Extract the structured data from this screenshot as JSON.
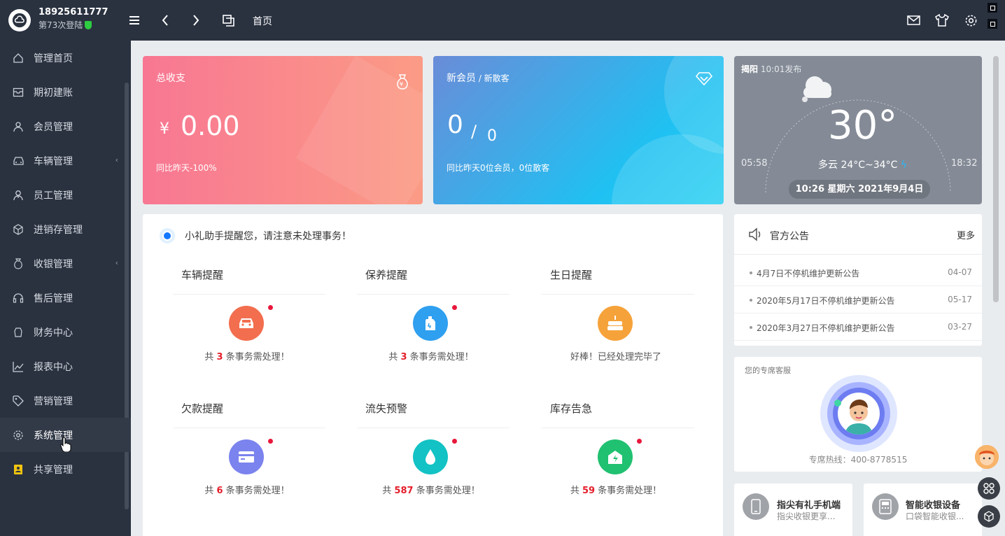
{
  "user": {
    "phone": "18925611777",
    "login_count": "第73次登陆"
  },
  "topbar": {
    "title": "首页"
  },
  "menu": [
    {
      "label": "管理首页",
      "icon": "home-icon"
    },
    {
      "label": "期初建账",
      "icon": "inbox-icon"
    },
    {
      "label": "会员管理",
      "icon": "user-icon"
    },
    {
      "label": "车辆管理",
      "icon": "car-icon",
      "arrow": "‹"
    },
    {
      "label": "员工管理",
      "icon": "staff-icon"
    },
    {
      "label": "进销存管理",
      "icon": "box-icon"
    },
    {
      "label": "收银管理",
      "icon": "money-bag-icon",
      "arrow": "‹"
    },
    {
      "label": "售后管理",
      "icon": "headset-icon"
    },
    {
      "label": "财务中心",
      "icon": "finance-icon"
    },
    {
      "label": "报表中心",
      "icon": "chart-icon"
    },
    {
      "label": "营销管理",
      "icon": "tag-icon"
    },
    {
      "label": "系统管理",
      "icon": "gear-icon"
    },
    {
      "label": "共享管理",
      "icon": "share-icon"
    }
  ],
  "revenue": {
    "title": "总收支",
    "currency": "¥",
    "value": "0.00",
    "compare": "同比昨天-100%"
  },
  "members": {
    "title": "新会员",
    "title_sub": " / 新散客",
    "new_members": "0",
    "slash": "/",
    "new_guests": "0",
    "compare": "同比昨天0位会员，0位散客"
  },
  "weather": {
    "city": "揭阳",
    "publish": "10:01发布",
    "temp": "30°",
    "desc": "多云 24°C~34°C",
    "sunrise": "05:58",
    "sunset": "18:32",
    "datetime": "10:26 星期六 2021年9月4日"
  },
  "reminder": {
    "header": "小礼助手提醒您，请注意未处理事务！",
    "cells": [
      {
        "title": "车辆提醒",
        "prefix": "共 ",
        "count": "3",
        "suffix": " 条事务需处理！",
        "color": "#f26e4f",
        "icon": "car-icon",
        "dot": true
      },
      {
        "title": "保养提醒",
        "prefix": "共 ",
        "count": "3",
        "suffix": " 条事务需处理！",
        "color": "#2f9ff0",
        "icon": "oil-can-icon",
        "dot": true
      },
      {
        "title": "生日提醒",
        "prefix": "好棒！已经处理完毕了",
        "count": "",
        "suffix": "",
        "color": "#f6a23a",
        "icon": "cake-icon",
        "dot": false
      },
      {
        "title": "欠款提醒",
        "prefix": "共 ",
        "count": "6",
        "suffix": " 条事务需处理！",
        "color": "#7b83ee",
        "icon": "card-icon",
        "dot": true
      },
      {
        "title": "流失预警",
        "prefix": "共 ",
        "count": "587",
        "suffix": " 条事务需处理！",
        "color": "#12c2c4",
        "icon": "drop-icon",
        "dot": true
      },
      {
        "title": "库存告急",
        "prefix": "共 ",
        "count": "59",
        "suffix": " 条事务需处理！",
        "color": "#20c170",
        "icon": "warehouse-icon",
        "dot": true
      }
    ]
  },
  "notice": {
    "title": "官方公告",
    "more": "更多",
    "items": [
      {
        "text": "4月7日不停机维护更新公告",
        "date": "04-07"
      },
      {
        "text": "2020年5月17日不停机维护更新公告",
        "date": "05-17"
      },
      {
        "text": "2020年3月27日不停机维护更新公告",
        "date": "03-27"
      }
    ]
  },
  "service": {
    "title": "您的专席客服",
    "hotline": "专席热线：400-8778515"
  },
  "apps": [
    {
      "title": "指尖有礼手机端",
      "sub": "指尖收银更享..."
    },
    {
      "title": "智能收银设备",
      "sub": "口袋智能收银..."
    }
  ]
}
